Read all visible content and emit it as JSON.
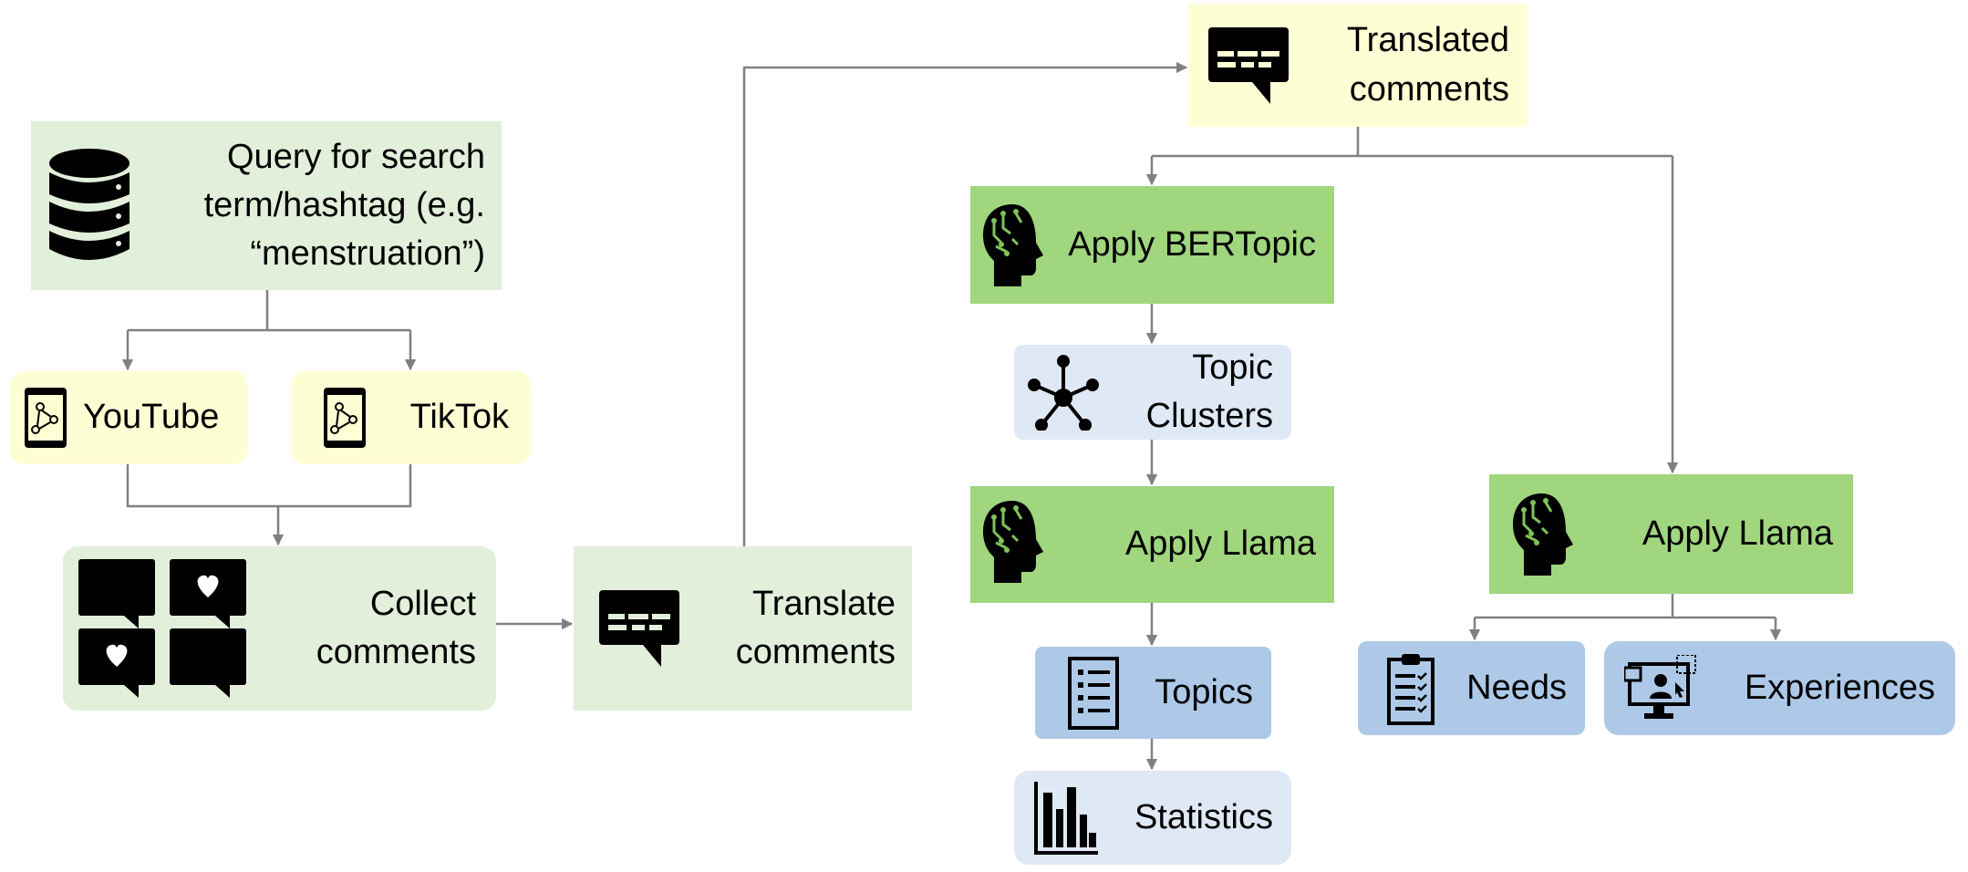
{
  "nodes": {
    "query": {
      "label": "Query for search term/hashtag (e.g. “menstruation”)",
      "icon": "database-icon"
    },
    "youtube": {
      "label": "YouTube",
      "icon": "phone-network-icon"
    },
    "tiktok": {
      "label": "TikTok",
      "icon": "phone-network-icon"
    },
    "collect": {
      "label": "Collect comments",
      "icon": "comment-bubbles-icon"
    },
    "translate": {
      "label": "Translate comments",
      "icon": "subtitle-bubble-icon"
    },
    "translated": {
      "label": "Translated comments",
      "icon": "subtitle-bubble-icon"
    },
    "bertopic": {
      "label": "Apply BERTopic",
      "icon": "ai-head-icon"
    },
    "clusters": {
      "label": "Topic Clusters",
      "icon": "cluster-icon"
    },
    "llama1": {
      "label": "Apply Llama",
      "icon": "ai-head-icon"
    },
    "topics": {
      "label": "Topics",
      "icon": "list-icon"
    },
    "statistics": {
      "label": "Statistics",
      "icon": "bar-chart-icon"
    },
    "llama2": {
      "label": "Apply Llama",
      "icon": "ai-head-icon"
    },
    "needs": {
      "label": "Needs",
      "icon": "clipboard-checklist-icon"
    },
    "experiences": {
      "label": "Experiences",
      "icon": "monitor-user-icon"
    }
  },
  "colors": {
    "light_green": "#e2efda",
    "yellow": "#fefed4",
    "green": "#a0d67e",
    "light_blue": "#dfe8f5",
    "blue": "#aec9e8",
    "connector": "#808080",
    "brain_circuit": "#7fc25a"
  }
}
